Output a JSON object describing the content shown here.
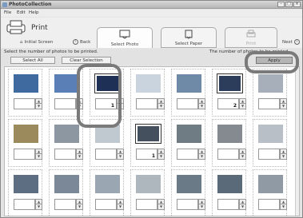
{
  "app": {
    "title": "PhotoCollection",
    "menu": [
      "File",
      "Edit",
      "Help"
    ]
  },
  "toolbar": {
    "print_label": "Print",
    "initial_screen_label": "Initial Screen",
    "back_label": "Back",
    "next_label": "Next"
  },
  "steps": [
    {
      "label": "Select Photo",
      "state": "active"
    },
    {
      "label": "Select Paper",
      "state": "normal"
    },
    {
      "label": "Print",
      "state": "disabled"
    }
  ],
  "hint": {
    "left": "Select the number of photos to be printed.",
    "right": "The number of photos to be printed."
  },
  "buttons": {
    "select_all": "Select All",
    "clear_selection": "Clear Selection",
    "apply": "Apply"
  },
  "photos": [
    {
      "count": "",
      "selected": false,
      "color": "#3f6aa0"
    },
    {
      "count": "",
      "selected": false,
      "color": "#5a7fb7"
    },
    {
      "count": "1",
      "selected": true,
      "color": "#1f3057"
    },
    {
      "count": "",
      "selected": false,
      "color": "#c9d4df"
    },
    {
      "count": "",
      "selected": false,
      "color": "#6f8aa7"
    },
    {
      "count": "2",
      "selected": true,
      "color": "#2c3d5c"
    },
    {
      "count": "",
      "selected": false,
      "color": "#a7b0ba"
    },
    {
      "count": "",
      "selected": false,
      "color": "#9b8a5c"
    },
    {
      "count": "",
      "selected": false,
      "color": "#8d97a2"
    },
    {
      "count": "",
      "selected": false,
      "color": "#c0c8d0"
    },
    {
      "count": "1",
      "selected": true,
      "color": "#44505d"
    },
    {
      "count": "",
      "selected": false,
      "color": "#6f7c84"
    },
    {
      "count": "",
      "selected": false,
      "color": "#848a8f"
    },
    {
      "count": "",
      "selected": false,
      "color": "#b8bfc6"
    },
    {
      "count": "",
      "selected": false,
      "color": "#5e6e82"
    },
    {
      "count": "",
      "selected": false,
      "color": "#7b8898"
    },
    {
      "count": "",
      "selected": false,
      "color": "#9aa7b3"
    },
    {
      "count": "",
      "selected": false,
      "color": "#aeb6be"
    },
    {
      "count": "",
      "selected": false,
      "color": "#6b7a87"
    },
    {
      "count": "",
      "selected": false,
      "color": "#5a6a78"
    },
    {
      "count": "",
      "selected": false,
      "color": "#8f9aa5"
    }
  ]
}
